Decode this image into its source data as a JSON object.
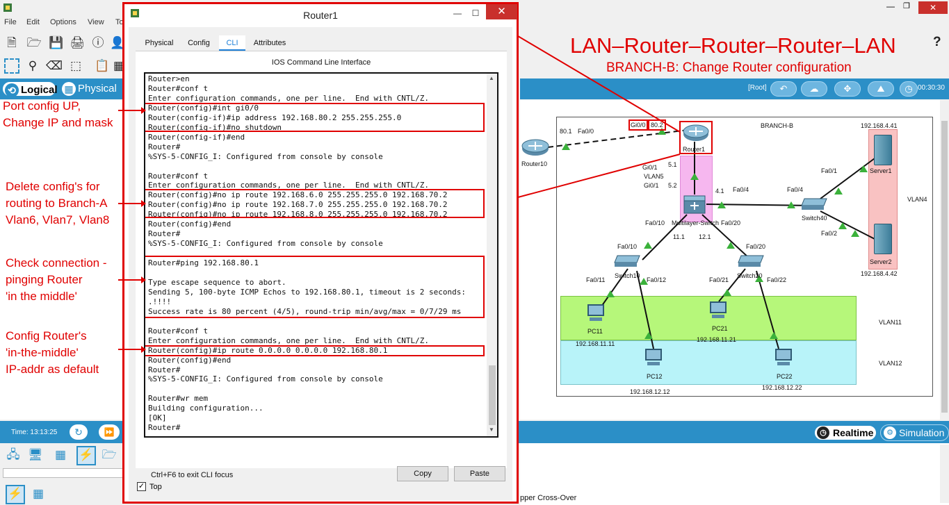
{
  "main": {
    "menu": [
      "File",
      "Edit",
      "Options",
      "View",
      "To"
    ],
    "logical_tab": "Logical",
    "physical_tab": "Physical",
    "root_label": "[Root]",
    "clock_right": "00:30:30",
    "time_label": "Time: 13:13:25",
    "realtime_button": "Realtime",
    "simulation_button": "Simulation",
    "cable_label": "pper Cross-Over",
    "help": "?"
  },
  "dialog": {
    "title": "Router1",
    "tabs": [
      "Physical",
      "Config",
      "CLI",
      "Attributes"
    ],
    "active_tab": "CLI",
    "header": "IOS Command Line Interface",
    "terminal_lines": [
      "Router>en",
      "Router#conf t",
      "Enter configuration commands, one per line.  End with CNTL/Z.",
      "Router(config)#int gi0/0",
      "Router(config-if)#ip address 192.168.80.2 255.255.255.0",
      "Router(config-if)#no shutdown",
      "Router(config-if)#end",
      "Router#",
      "%SYS-5-CONFIG_I: Configured from console by console",
      "",
      "Router#conf t",
      "Enter configuration commands, one per line.  End with CNTL/Z.",
      "Router(config)#no ip route 192.168.6.0 255.255.255.0 192.168.70.2",
      "Router(config)#no ip route 192.168.7.0 255.255.255.0 192.168.70.2",
      "Router(config)#no ip route 192.168.8.0 255.255.255.0 192.168.70.2",
      "Router(config)#end",
      "Router#",
      "%SYS-5-CONFIG_I: Configured from console by console",
      "",
      "Router#ping 192.168.80.1",
      "",
      "Type escape sequence to abort.",
      "Sending 5, 100-byte ICMP Echos to 192.168.80.1, timeout is 2 seconds:",
      ".!!!!",
      "Success rate is 80 percent (4/5), round-trip min/avg/max = 0/7/29 ms",
      "",
      "Router#conf t",
      "Enter configuration commands, one per line.  End with CNTL/Z.",
      "Router(config)#ip route 0.0.0.0 0.0.0.0 192.168.80.1",
      "Router(config)#end",
      "Router#",
      "%SYS-5-CONFIG_I: Configured from console by console",
      "",
      "Router#wr mem",
      "Building configuration...",
      "[OK]",
      "Router#"
    ],
    "hint": "Ctrl+F6 to exit CLI focus",
    "copy_button": "Copy",
    "paste_button": "Paste",
    "top_checkbox_label": "Top",
    "top_checked": true
  },
  "annotations": {
    "title": "LAN–Router–Router–Router–LAN",
    "subtitle": "BRANCH-B: Change Router configuration",
    "port_config": [
      "Port config UP,",
      "Change IP and mask"
    ],
    "delete_config": [
      "Delete config's for",
      "routing to Branch-A",
      "Vlan6, Vlan7, Vlan8"
    ],
    "check_conn": [
      "Check connection -",
      "pinging Router",
      "'in the middle'"
    ],
    "config_default": [
      "Config Router's",
      "'in-the-middle'",
      "IP-addr as default"
    ]
  },
  "topology": {
    "branch": "BRANCH-B",
    "labels": {
      "r10_ip": "80.1",
      "r10_if": "Fa0/0",
      "gi00": "Gi0/0",
      "ip802": "80.2",
      "router1": "Router1",
      "router10": "Router10",
      "gi01a": "Gi0/1",
      "ip51": "5.1",
      "vlan5": "VLAN5",
      "gi01b": "Gi0/1",
      "ip52": "5.2",
      "ip41": "4.1",
      "fa04a": "Fa0/4",
      "fa04b": "Fa0/4",
      "mls": "Multilayer-Switch",
      "fa010": "Fa0/10",
      "fa020": "Fa0/20",
      "ip111": "11.1",
      "ip121": "12.1",
      "switch40": "Switch40",
      "fa01": "Fa0/1",
      "fa02": "Fa0/2",
      "server1": "Server1",
      "server2": "Server2",
      "srv1_ip": "192.168.4.41",
      "srv2_ip": "192.168.4.42",
      "vlan4": "VLAN4",
      "sw10_fa010": "Fa0/10",
      "sw20_fa020": "Fa0/20",
      "switch10": "Switch10",
      "switch20": "Switch20",
      "fa011": "Fa0/11",
      "fa012": "Fa0/12",
      "fa021": "Fa0/21",
      "fa022": "Fa0/22",
      "pc11": "PC11",
      "pc21": "PC21",
      "pc12": "PC12",
      "pc22": "PC22",
      "pc11_ip": "192.168.11.11",
      "pc21_ip": "192.168.11.21",
      "pc12_ip": "192.168.12.12",
      "pc22_ip": "192.168.12.22",
      "vlan11": "VLAN11",
      "vlan12": "VLAN12"
    }
  },
  "colors": {
    "accent_blue": "#2b8fc7",
    "annotation_red": "#e00000",
    "link_green": "#3bb13b"
  }
}
